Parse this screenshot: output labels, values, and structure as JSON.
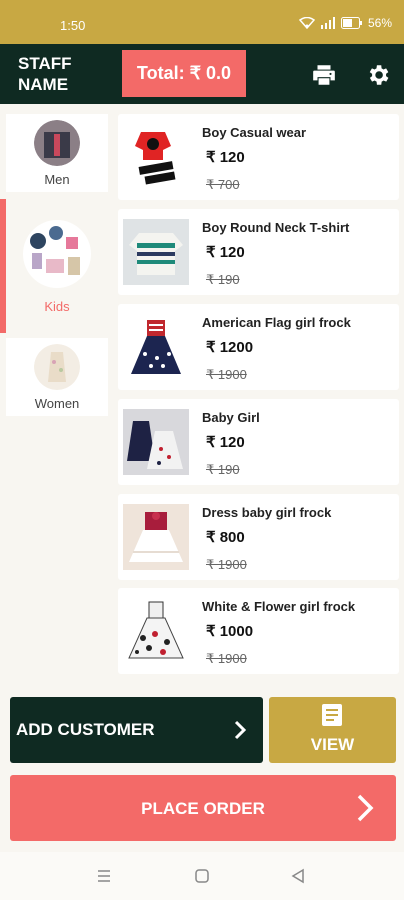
{
  "status_bar": {
    "time": "1:50",
    "battery": "56%"
  },
  "header": {
    "staff_name": "STAFF NAME",
    "total_label": "Total: ₹ 0.0",
    "icons": [
      "print-icon",
      "gear-icon"
    ]
  },
  "categories": [
    {
      "label": "Men",
      "active": false
    },
    {
      "label": "Kids",
      "active": true
    },
    {
      "label": "Women",
      "active": false
    }
  ],
  "products": [
    {
      "name": "Boy Casual wear",
      "price": "₹  120",
      "mrp": "₹ 700"
    },
    {
      "name": "Boy Round Neck T-shirt",
      "price": "₹  120",
      "mrp": "₹ 190"
    },
    {
      "name": "American Flag girl frock",
      "price": "₹  1200",
      "mrp": "₹ 1900"
    },
    {
      "name": "Baby Girl",
      "price": "₹  120",
      "mrp": "₹ 190"
    },
    {
      "name": "Dress baby girl frock",
      "price": "₹  800",
      "mrp": "₹ 1900"
    },
    {
      "name": "White & Flower girl frock",
      "price": "₹  1000",
      "mrp": "₹ 1900"
    }
  ],
  "actions": {
    "add_customer": "ADD CUSTOMER",
    "view": "VIEW",
    "place_order": "PLACE ORDER"
  },
  "colors": {
    "accent_gold": "#c8a843",
    "dark_green": "#0f2a22",
    "coral": "#f36a68",
    "kids_label": "#f36a68"
  }
}
